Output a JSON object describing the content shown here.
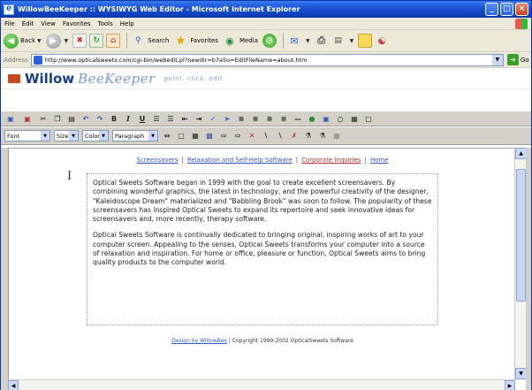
{
  "window": {
    "title": "WillowBeeKeeper :: WYSIWYG Web Editor - Microsoft Internet Explorer",
    "controls": {
      "minimize": "_",
      "maximize": "□",
      "close": "×"
    }
  },
  "menu": {
    "items": [
      "File",
      "Edit",
      "View",
      "Favorites",
      "Tools",
      "Help"
    ]
  },
  "toolbar": {
    "back_label": "Back",
    "search_label": "Search",
    "favorites_label": "Favorites",
    "media_label": "Media"
  },
  "address": {
    "label": "Address",
    "url": "http://www.opticalsweets.com/cgi-bin/webedit.pl?newdir=b7a5o=EditFileName=about.htm",
    "go_label": "Go"
  },
  "brand": {
    "willow": "Willow",
    "beekeeper": "BeeKeeper",
    "tagline": "point. click. edit"
  },
  "editor_toolbar": {
    "font_label": "Font",
    "size_label": "Size",
    "color_label": "Color",
    "format_label": "Paragraph"
  },
  "content": {
    "nav": [
      {
        "label": "Screensavers"
      },
      {
        "label": "Relaxation and Self-Help Software"
      },
      {
        "label": "Corporate Inquiries"
      },
      {
        "label": "Home"
      }
    ],
    "nav_separator": "|",
    "paragraph1": "Optical Sweets Software began in 1999 with the goal to create excellent screensavers. By combining wonderful graphics, the latest in technology, and the powerful creativity of the designer, \"Kaleidoscope Dream\" materialized and \"Babbling Brook\" was soon to follow. The popularity of these screensavers has inspired Optical Sweets to expand its repertoire and seek innovative ideas for screensavers and, more recently, therapy software.",
    "paragraph2": "Optical Sweets Software is continually dedicated to bringing original, inspiring works of art to your computer screen. Appealing to the senses, Optical Sweets transforms your computer into a source of relaxation and inspiration. For home or office, pleasure or function, Optical Sweets aims to bring quality products to the computer world.",
    "footer_link": "Design by WillowBee",
    "footer_text": " | Copyright 1999-2002 OpticalSweets Software"
  },
  "colors": {
    "titlebar": "#1b54d6",
    "link": "#3355cc",
    "link_active": "#b03030",
    "brand_dark": "#1a3d8a",
    "brand_light": "#7a9ad0"
  }
}
